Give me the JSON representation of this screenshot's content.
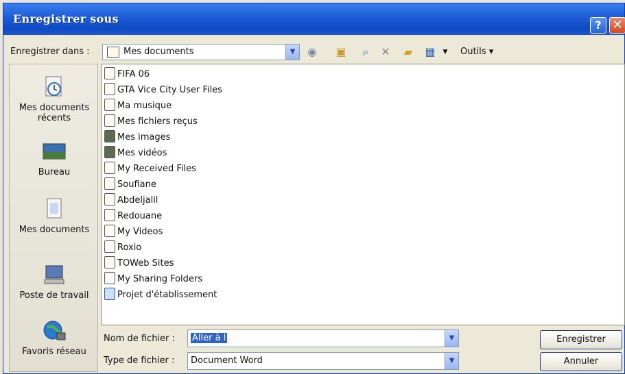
{
  "window": {
    "title": "Enregistrer sous",
    "help_glyph": "?",
    "close_glyph": "✕"
  },
  "save_in": {
    "label": "Enregistrer dans :",
    "value": "Mes documents"
  },
  "toolbar": {
    "icons": [
      "back-icon",
      "up-folder-icon",
      "search-web-icon",
      "delete-icon",
      "new-folder-icon",
      "views-icon"
    ],
    "tools_label": "Outils"
  },
  "places": [
    {
      "label": "Mes documents récents",
      "icon": "recent-documents-icon"
    },
    {
      "label": "Bureau",
      "icon": "desktop-icon"
    },
    {
      "label": "Mes documents",
      "icon": "my-documents-icon"
    },
    {
      "label": "Poste de travail",
      "icon": "my-computer-icon"
    },
    {
      "label": "Favoris réseau",
      "icon": "network-places-icon"
    }
  ],
  "files": [
    "FIFA 06",
    "GTA Vice City User Files",
    "Ma musique",
    "Mes fichiers reçus",
    "Mes images",
    "Mes vidéos",
    "My Received Files",
    "Soufiane",
    "Abdeljalil",
    "Redouane",
    "My Videos",
    "Roxio",
    "TOWeb Sites",
    "My Sharing Folders",
    "Projet d'établissement"
  ],
  "filename": {
    "label": "Nom de fichier :",
    "value": "Aller à l"
  },
  "filetype": {
    "label": "Type de fichier :",
    "value": "Document Word"
  },
  "buttons": {
    "save": "Enregistrer",
    "cancel": "Annuler"
  },
  "colors": {
    "titlebar": "#1f5fd9",
    "dialog_bg": "#ece9d8",
    "selection": "#3163c5"
  }
}
